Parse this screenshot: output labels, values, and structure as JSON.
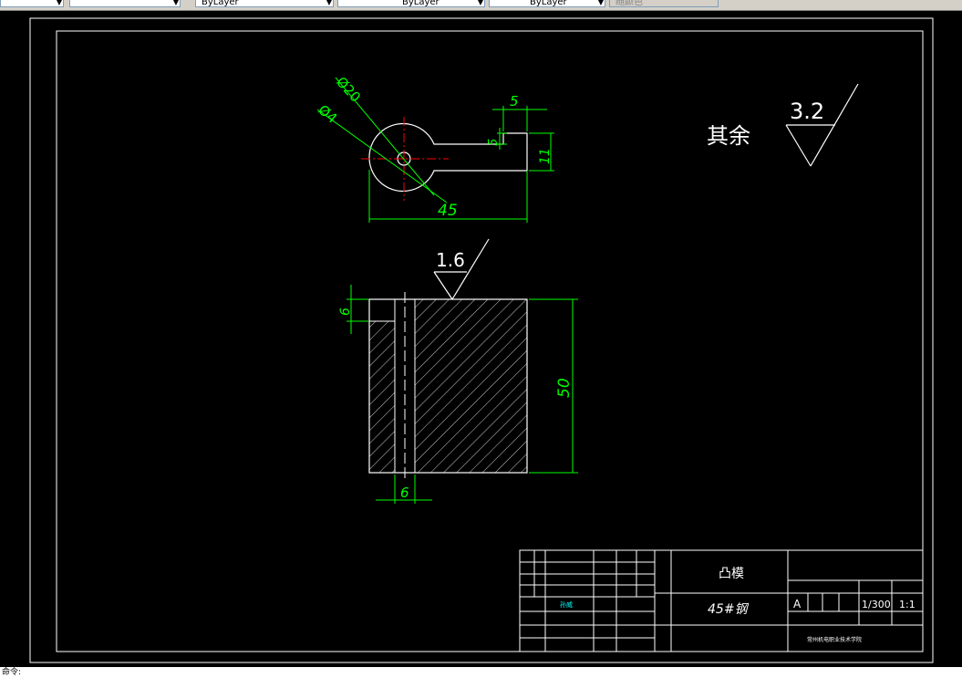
{
  "toolbar": {
    "layer_field": "",
    "color_field": "ByLayer",
    "linetype_field": "ByLayer",
    "lineweight_field": "ByLayer",
    "plotstyle_field": "随颜色"
  },
  "drawing": {
    "dimensions": {
      "dia_outer": "Ø20",
      "dia_inner": "Ø4",
      "slot_width": "5",
      "slot_depth": "5",
      "height_top": "11",
      "length": "45",
      "thickness": "6",
      "height": "50",
      "hole_width": "6"
    },
    "roughness_top": "1.6",
    "roughness_rest_label": "其余",
    "roughness_rest_value": "3.2"
  },
  "title_block": {
    "part_name": "凸模",
    "material": "45#钢",
    "stage_mark": "A",
    "scale_weight": "1/300",
    "scale": "1:1",
    "school": "常州机电职业技术学院",
    "designer": "孙威"
  },
  "status": {
    "command_prompt": "命令:"
  },
  "colors": {
    "dimension": "#00ff00",
    "outline": "#ffffff",
    "center": "#ff0000",
    "background": "#000000"
  }
}
